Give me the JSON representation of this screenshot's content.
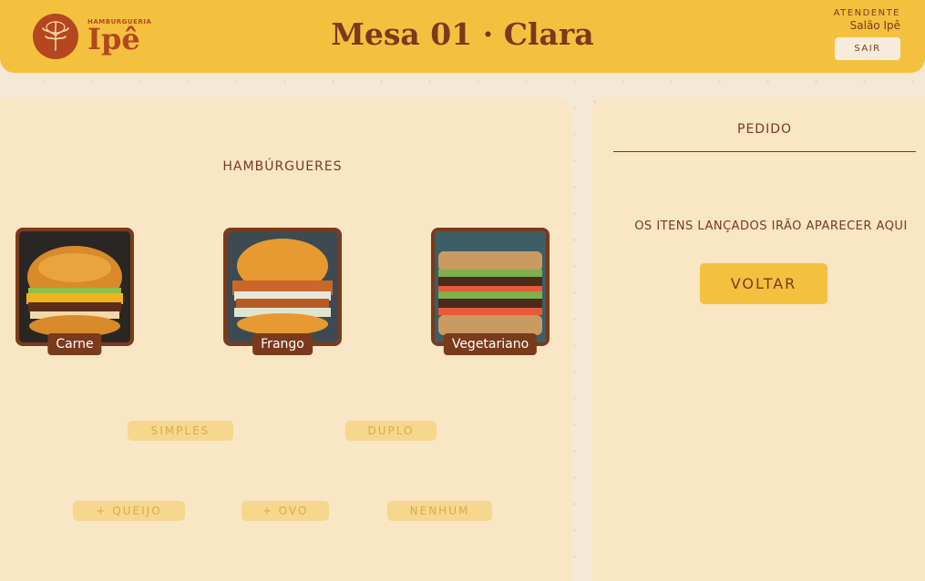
{
  "header": {
    "logo_small": "HAMBURGUERIA",
    "logo_big": "Ipê",
    "title": "Mesa 01 · Clara",
    "attendant_label": "ATENDENTE",
    "attendant_name": "Salão Ipê",
    "logout_label": "SAIR"
  },
  "menu": {
    "section_title": "HAMBÚRGUERES",
    "items": [
      {
        "label": "Carne",
        "image": "beef-burger-image"
      },
      {
        "label": "Frango",
        "image": "chicken-burger-image"
      },
      {
        "label": "Vegetariano",
        "image": "vegetarian-burger-image"
      }
    ],
    "size_options": [
      "SIMPLES",
      "DUPLO"
    ],
    "extra_options": [
      "+ QUEIJO",
      "+ OVO",
      "NENHUM"
    ]
  },
  "order": {
    "title": "PEDIDO",
    "empty_message": "OS ITENS LANÇADOS IRÃO APARECER AQUI",
    "back_label": "VOLTAR"
  },
  "colors": {
    "header_bg": "#f4c13f",
    "page_bg": "#f5e8d4",
    "panel_bg": "#f9e6c4",
    "brand_brown": "#7a3a1c",
    "logo_red": "#b4471f",
    "disabled_pill": "#f6d78e"
  }
}
